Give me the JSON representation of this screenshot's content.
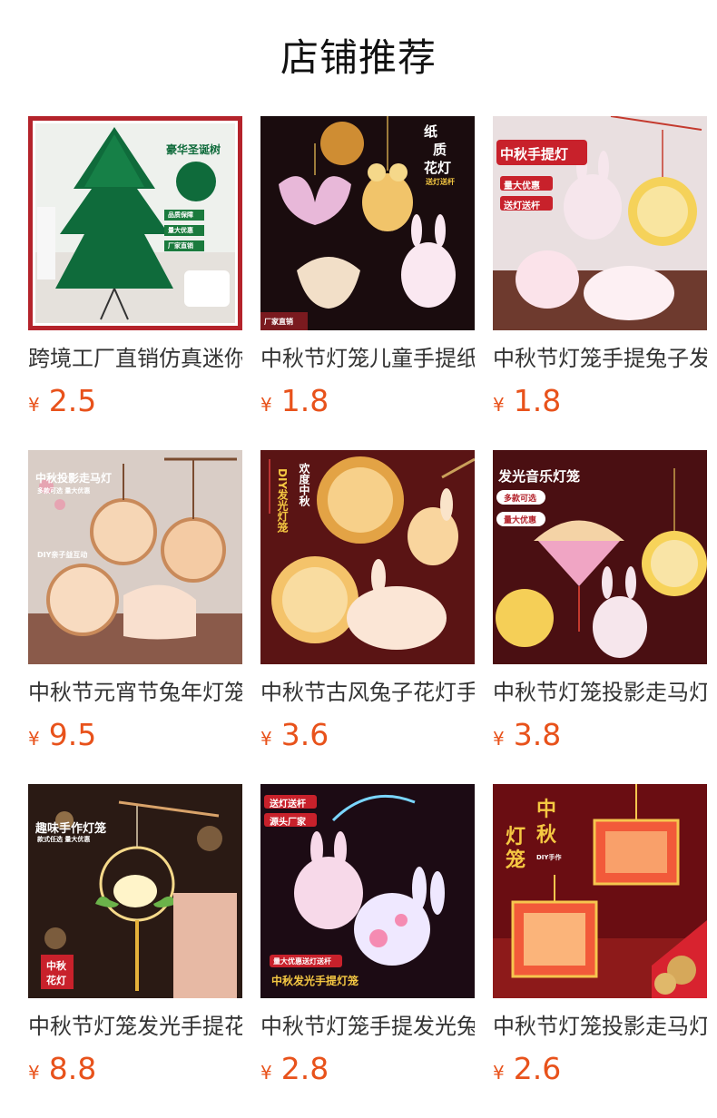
{
  "header": {
    "title": "店铺推荐"
  },
  "colors": {
    "price": "#e8521b",
    "title": "#111111",
    "text": "#333333"
  },
  "products": [
    {
      "name": "跨境工厂直销仿真迷你圣诞树",
      "currency": "¥",
      "price": "2.5",
      "badges": [
        "豪华圣诞树",
        "品质保障",
        "量大优惠",
        "厂家直销"
      ]
    },
    {
      "name": "中秋节灯笼儿童手提纸质花灯",
      "currency": "¥",
      "price": "1.8",
      "badges": [
        "纸",
        "质",
        "花灯",
        "送灯送杆",
        "厂家直销"
      ]
    },
    {
      "name": "中秋节灯笼手提兔子发光灯笼",
      "currency": "¥",
      "price": "1.8",
      "badges": [
        "中秋手提灯",
        "量大优惠",
        "送灯送杆"
      ]
    },
    {
      "name": "中秋节元宵节兔年灯笼投影",
      "currency": "¥",
      "price": "9.5",
      "badges": [
        "中秋投影走马灯",
        "多款可选 量大优惠",
        "DIY亲子益互动"
      ]
    },
    {
      "name": "中秋节古风兔子花灯手提",
      "currency": "¥",
      "price": "3.6",
      "badges": [
        "欢度中秋",
        "DIY发光灯笼"
      ]
    },
    {
      "name": "中秋节灯笼投影走马灯发光",
      "currency": "¥",
      "price": "3.8",
      "badges": [
        "发光音乐灯笼",
        "多款可选",
        "量大优惠"
      ]
    },
    {
      "name": "中秋节灯笼发光手提花环灯",
      "currency": "¥",
      "price": "8.8",
      "badges": [
        "趣味手作灯笼",
        "款式任选 量大优惠",
        "中秋",
        "花灯"
      ]
    },
    {
      "name": "中秋节灯笼手提发光兔子灯",
      "currency": "¥",
      "price": "2.8",
      "badges": [
        "送灯送杆",
        "源头厂家",
        "量大优惠送灯送杆",
        "中秋发光手提灯笼"
      ]
    },
    {
      "name": "中秋节灯笼投影走马灯手工",
      "currency": "¥",
      "price": "2.6",
      "badges": [
        "中",
        "秋",
        "灯",
        "笼",
        "DIY手作"
      ]
    }
  ]
}
